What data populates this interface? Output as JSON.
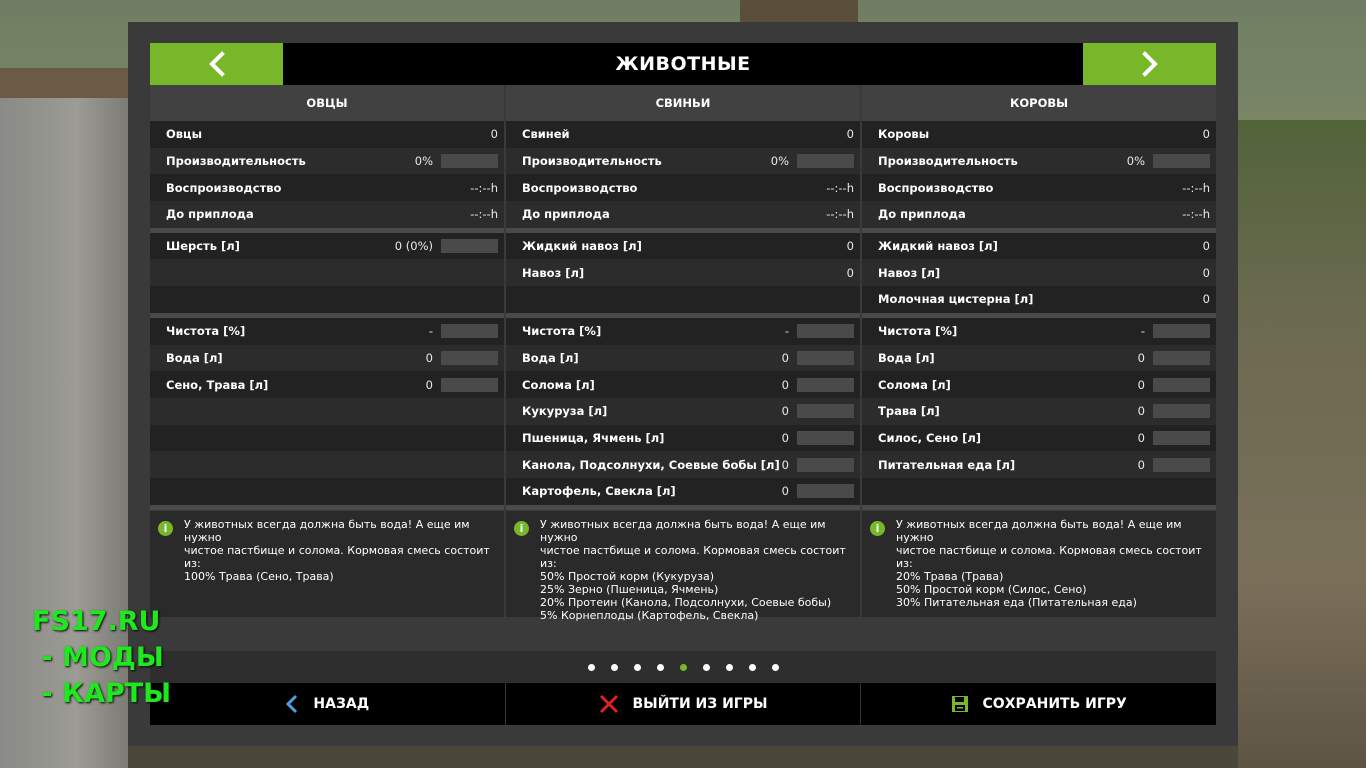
{
  "header": {
    "title": "ЖИВОТНЫЕ"
  },
  "columns": [
    {
      "title": "ОВЦЫ",
      "stats": [
        {
          "label": "Овцы",
          "value": "0"
        },
        {
          "label": "Производительность",
          "value": "0%"
        },
        {
          "label": "Воспроизводство",
          "value": "--:--h"
        },
        {
          "label": "До приплода",
          "value": "--:--h"
        }
      ],
      "products": [
        {
          "label": "Шерсть [л]",
          "value": "0 (0%)"
        },
        {
          "label": "",
          "value": ""
        },
        {
          "label": "",
          "value": ""
        }
      ],
      "needs": [
        {
          "label": "Чистота [%]",
          "value": "-"
        },
        {
          "label": "Вода [л]",
          "value": "0"
        },
        {
          "label": "Сено, Трава [л]",
          "value": "0"
        },
        {
          "label": "",
          "value": ""
        },
        {
          "label": "",
          "value": ""
        },
        {
          "label": "",
          "value": ""
        },
        {
          "label": "",
          "value": ""
        }
      ],
      "info": "У животных всегда должна быть вода! А еще им нужно\nчистое пастбище и солома. Кормовая смесь состоит\nиз:\n100% Трава (Сено, Трава)"
    },
    {
      "title": "СВИНЬИ",
      "stats": [
        {
          "label": "Свиней",
          "value": "0"
        },
        {
          "label": "Производительность",
          "value": "0%"
        },
        {
          "label": "Воспроизводство",
          "value": "--:--h"
        },
        {
          "label": "До приплода",
          "value": "--:--h"
        }
      ],
      "products": [
        {
          "label": "Жидкий навоз [л]",
          "value": "0"
        },
        {
          "label": "Навоз [л]",
          "value": "0"
        },
        {
          "label": "",
          "value": ""
        }
      ],
      "needs": [
        {
          "label": "Чистота [%]",
          "value": "-"
        },
        {
          "label": "Вода [л]",
          "value": "0"
        },
        {
          "label": "Солома [л]",
          "value": "0"
        },
        {
          "label": "Кукуруза [л]",
          "value": "0"
        },
        {
          "label": "Пшеница, Ячмень [л]",
          "value": "0"
        },
        {
          "label": "Канола, Подсолнухи, Соевые бобы [л]",
          "value": "0"
        },
        {
          "label": "Картофель, Свекла [л]",
          "value": "0"
        }
      ],
      "info": "У животных всегда должна быть вода! А еще им нужно\nчистое пастбище и солома. Кормовая смесь состоит\nиз:\n50% Простой корм (Кукуруза)\n25% Зерно (Пшеница, Ячмень)\n20% Протеин (Канола, Подсолнухи, Соевые бобы)\n5% Корнеплоды (Картофель, Свекла)"
    },
    {
      "title": "КОРОВЫ",
      "stats": [
        {
          "label": "Коровы",
          "value": "0"
        },
        {
          "label": "Производительность",
          "value": "0%"
        },
        {
          "label": "Воспроизводство",
          "value": "--:--h"
        },
        {
          "label": "До приплода",
          "value": "--:--h"
        }
      ],
      "products": [
        {
          "label": "Жидкий навоз [л]",
          "value": "0"
        },
        {
          "label": "Навоз [л]",
          "value": "0"
        },
        {
          "label": "Молочная цистерна [л]",
          "value": "0"
        }
      ],
      "needs": [
        {
          "label": "Чистота [%]",
          "value": "-"
        },
        {
          "label": "Вода [л]",
          "value": "0"
        },
        {
          "label": "Солома [л]",
          "value": "0"
        },
        {
          "label": "Трава [л]",
          "value": "0"
        },
        {
          "label": "Силос, Сено [л]",
          "value": "0"
        },
        {
          "label": "Питательная еда [л]",
          "value": "0"
        },
        {
          "label": "",
          "value": ""
        }
      ],
      "info": "У животных всегда должна быть вода! А еще им нужно\nчистое пастбище и солома. Кормовая смесь состоит\nиз:\n20% Трава (Трава)\n50% Простой корм (Силос, Сено)\n30% Питательная еда (Питательная еда)"
    }
  ],
  "pagination": {
    "count": 9,
    "active": 4
  },
  "footer": {
    "back_label": "НАЗАД",
    "quit_label": "ВЫЙТИ ИЗ ИГРЫ",
    "save_label": "СОХРАНИТЬ ИГРУ"
  },
  "watermark": {
    "line1": "FS17.RU",
    "line2": " - МОДЫ",
    "line3": " - КАРТЫ"
  },
  "colors": {
    "accent": "#78b72a",
    "quit": "#e02020"
  },
  "icons": {
    "prev": "chevron-left-icon",
    "next": "chevron-right-icon",
    "back": "chevron-left-icon",
    "quit": "close-x-icon",
    "save": "floppy-disk-icon",
    "info": "info-icon"
  }
}
